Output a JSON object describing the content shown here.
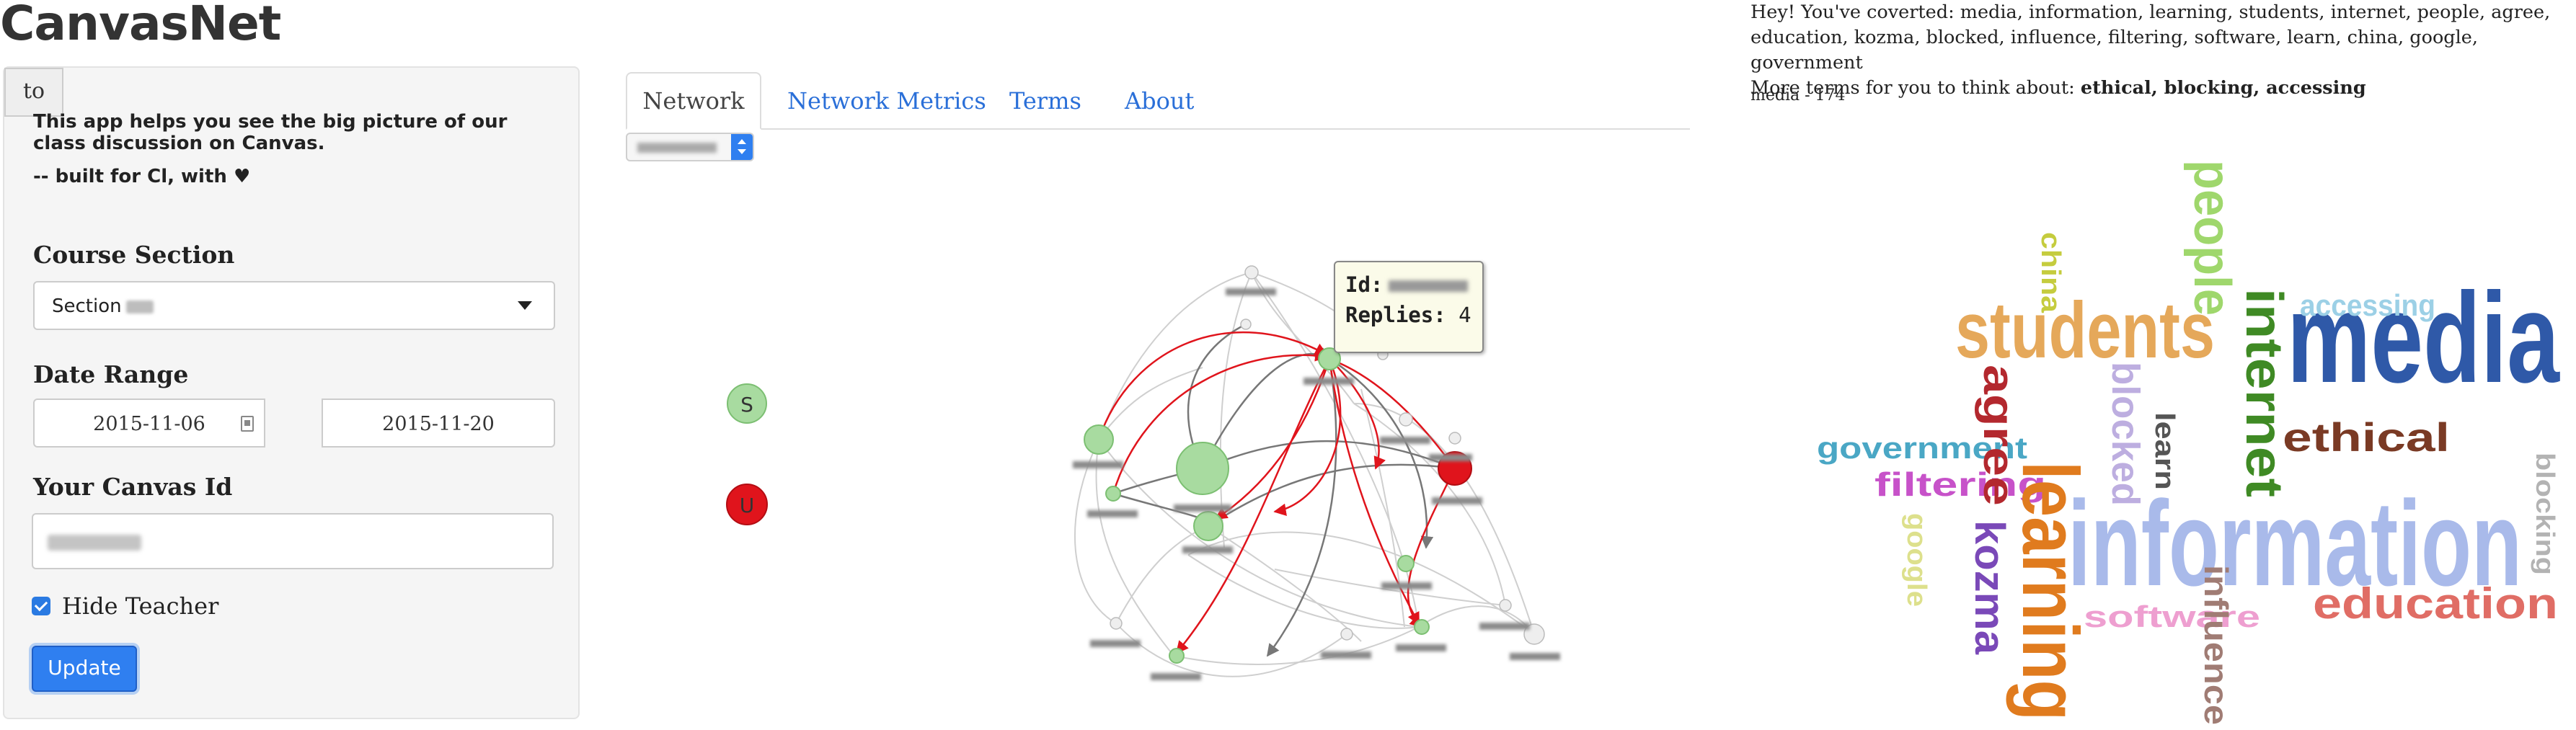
{
  "app": {
    "title": "CanvasNet",
    "intro_line1": "This app helps you see the big picture of our class discussion on Canvas.",
    "intro_line2": "-- built for Cl, with ♥"
  },
  "sidebar": {
    "course_section_label": "Course Section",
    "course_section_value": "Section",
    "date_range_label": "Date Range",
    "date_start": "2015-11-06",
    "date_to": "to",
    "date_end": "2015-11-20",
    "canvas_id_label": "Your Canvas Id",
    "hide_teacher_label": "Hide Teacher",
    "hide_teacher_checked": true,
    "update_label": "Update"
  },
  "tabs": [
    {
      "label": "Network",
      "active": true
    },
    {
      "label": "Network Metrics",
      "active": false
    },
    {
      "label": "Terms",
      "active": false
    },
    {
      "label": "About",
      "active": false
    }
  ],
  "network": {
    "legend": [
      {
        "label": "S",
        "color": "#a8dba0"
      },
      {
        "label": "U",
        "color": "#e0141c"
      }
    ],
    "tooltip": {
      "id_key": "Id:",
      "replies_key": "Replies:",
      "replies_value": "4"
    }
  },
  "terms": {
    "summary_prefix": "Hey! You've coverted:",
    "covered": "media, information, learning, students, internet, people, agree, education, kozma, blocked, influence, filtering, software, learn, china, google, government",
    "more_prefix": "More terms for you to think about:",
    "more": "ethical, blocking, accessing",
    "selected_term": "media - 174"
  },
  "wordcloud": [
    {
      "text": "media",
      "color": "#2f59a8"
    },
    {
      "text": "information",
      "color": "#a9baea"
    },
    {
      "text": "learning",
      "color": "#e07b1e"
    },
    {
      "text": "students",
      "color": "#e5a85a"
    },
    {
      "text": "internet",
      "color": "#3f8a24"
    },
    {
      "text": "people",
      "color": "#9fd76c"
    },
    {
      "text": "agree",
      "color": "#b3282e"
    },
    {
      "text": "education",
      "color": "#e06d65"
    },
    {
      "text": "kozma",
      "color": "#7a49b8"
    },
    {
      "text": "blocked",
      "color": "#bdaee0"
    },
    {
      "text": "influence",
      "color": "#a07c74"
    },
    {
      "text": "filtering",
      "color": "#c752c9"
    },
    {
      "text": "software",
      "color": "#ee9fd0"
    },
    {
      "text": "learn",
      "color": "#555555"
    },
    {
      "text": "china",
      "color": "#c5cc3e"
    },
    {
      "text": "google",
      "color": "#dde08c"
    },
    {
      "text": "government",
      "color": "#4aa7c5"
    },
    {
      "text": "ethical",
      "color": "#7a3a24"
    },
    {
      "text": "blocking",
      "color": "#b3b3b3"
    },
    {
      "text": "accessing",
      "color": "#9cd0e6"
    }
  ]
}
